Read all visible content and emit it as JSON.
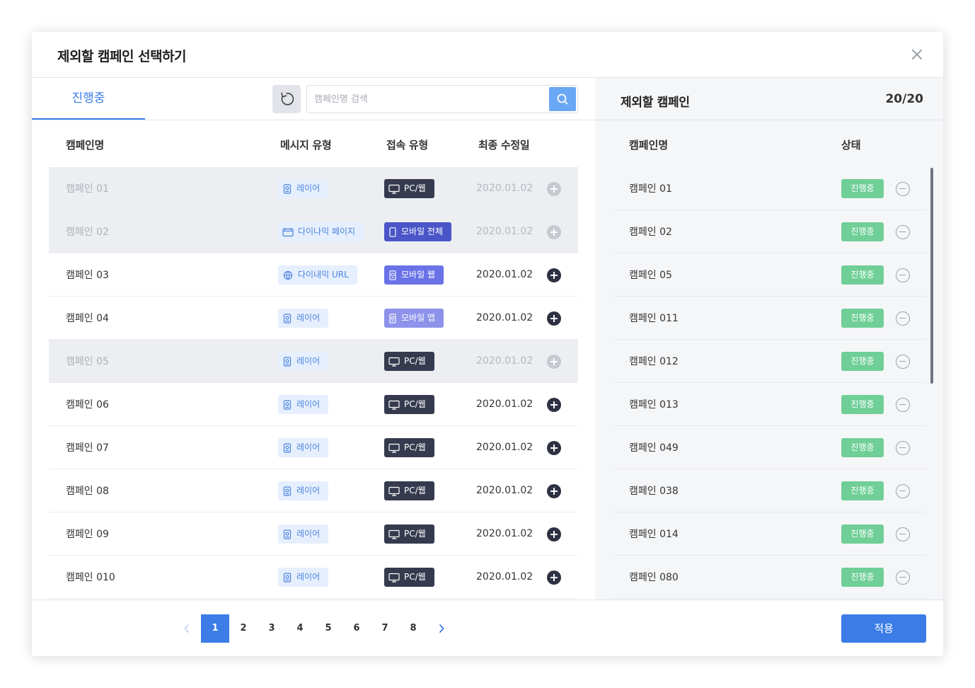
{
  "dialog": {
    "title": "제외할 캠페인 선택하기",
    "close_icon": "close-icon"
  },
  "left": {
    "tab_label": "진행중",
    "search_placeholder": "캠페인명 검색",
    "columns": [
      "캠페인명",
      "메시지 유형",
      "접속 유형",
      "최종 수정일"
    ],
    "rows": [
      {
        "name": "캠페인 01",
        "msg_type": "레이어",
        "msg_icon": "layer-icon",
        "access": "PC/웹",
        "access_kind": "pc",
        "date": "2020.01.02",
        "disabled": true
      },
      {
        "name": "캠페인 02",
        "msg_type": "다이나믹 페이지",
        "msg_icon": "dynamic-page-icon",
        "access": "모바일 전체",
        "access_kind": "mobile-all",
        "date": "2020.01.02",
        "disabled": true
      },
      {
        "name": "캠페인 03",
        "msg_type": "다이내믹 URL",
        "msg_icon": "dynamic-url-icon",
        "access": "모바일 웹",
        "access_kind": "mobile-web",
        "date": "2020.01.02",
        "disabled": false
      },
      {
        "name": "캠페인 04",
        "msg_type": "레이어",
        "msg_icon": "layer-icon",
        "access": "모바일 앱",
        "access_kind": "mobile-app",
        "date": "2020.01.02",
        "disabled": false
      },
      {
        "name": "캠페인 05",
        "msg_type": "레이어",
        "msg_icon": "layer-icon",
        "access": "PC/웹",
        "access_kind": "pc",
        "date": "2020.01.02",
        "disabled": true
      },
      {
        "name": "캠페인 06",
        "msg_type": "레이어",
        "msg_icon": "layer-icon",
        "access": "PC/웹",
        "access_kind": "pc",
        "date": "2020.01.02",
        "disabled": false
      },
      {
        "name": "캠페인 07",
        "msg_type": "레이어",
        "msg_icon": "layer-icon",
        "access": "PC/웹",
        "access_kind": "pc",
        "date": "2020.01.02",
        "disabled": false
      },
      {
        "name": "캠페인 08",
        "msg_type": "레이어",
        "msg_icon": "layer-icon",
        "access": "PC/웹",
        "access_kind": "pc",
        "date": "2020.01.02",
        "disabled": false
      },
      {
        "name": "캠페인 09",
        "msg_type": "레이어",
        "msg_icon": "layer-icon",
        "access": "PC/웹",
        "access_kind": "pc",
        "date": "2020.01.02",
        "disabled": false
      },
      {
        "name": "캠페인 010",
        "msg_type": "레이어",
        "msg_icon": "layer-icon",
        "access": "PC/웹",
        "access_kind": "pc",
        "date": "2020.01.02",
        "disabled": false
      }
    ]
  },
  "right": {
    "title": "제외할 캠페인",
    "count": "20/20",
    "columns": [
      "캠페인명",
      "상태"
    ],
    "rows": [
      {
        "name": "캠페인 01",
        "status": "진행중"
      },
      {
        "name": "캠페인 02",
        "status": "진행중"
      },
      {
        "name": "캠페인 05",
        "status": "진행중"
      },
      {
        "name": "캠페인 011",
        "status": "진행중"
      },
      {
        "name": "캠페인 012",
        "status": "진행중"
      },
      {
        "name": "캠페인 013",
        "status": "진행중"
      },
      {
        "name": "캠페인 049",
        "status": "진행중"
      },
      {
        "name": "캠페인 038",
        "status": "진행중"
      },
      {
        "name": "캠페인 014",
        "status": "진행중"
      },
      {
        "name": "캠페인 080",
        "status": "진행중"
      }
    ]
  },
  "pagination": {
    "pages": [
      "1",
      "2",
      "3",
      "4",
      "5",
      "6",
      "7",
      "8"
    ],
    "current": "1"
  },
  "footer": {
    "apply_label": "적용"
  },
  "colors": {
    "accent": "#3b7ce6",
    "status_green": "#6fcf97",
    "pc_chip": "#363a4e",
    "mobile_all_chip": "#4a55c8",
    "mobile_web_chip": "#6a72e8",
    "mobile_app_chip": "#8d93ea"
  }
}
